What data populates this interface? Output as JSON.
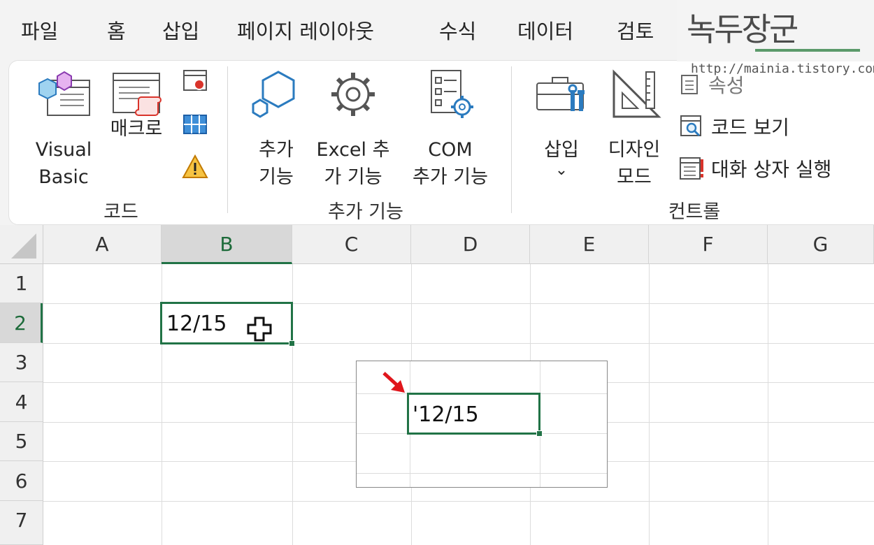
{
  "menu": {
    "tabs": [
      "파일",
      "홈",
      "삽입",
      "페이지 레이아웃",
      "수식",
      "데이터",
      "검토"
    ]
  },
  "watermark": {
    "title": "녹두장군",
    "url": "http://mainia.tistory.com"
  },
  "ribbon": {
    "groups": {
      "code": {
        "label": "코드",
        "visual_basic": [
          "Visual",
          "Basic"
        ],
        "macro": "매크로",
        "small_icons": [
          "record-macro-icon",
          "relative-reference-icon",
          "macro-security-icon"
        ]
      },
      "addins": {
        "label": "추가 기능",
        "addins_button": [
          "추가",
          "기능"
        ],
        "excel_addins": [
          "Excel 추",
          "가 기능"
        ],
        "com_addins": [
          "COM",
          "추가 기능"
        ]
      },
      "controls": {
        "label": "컨트롤",
        "insert": "삽입",
        "insert_chevron": "⌄",
        "design_mode": [
          "디자인",
          "모드"
        ],
        "properties": "속성",
        "view_code": "코드 보기",
        "run_dialog": "대화 상자 실행"
      }
    }
  },
  "sheet": {
    "columns": [
      "A",
      "B",
      "C",
      "D",
      "E",
      "F",
      "G"
    ],
    "selected_column": "B",
    "rows": [
      "1",
      "2",
      "3",
      "4",
      "5",
      "6",
      "7"
    ],
    "selected_row": "2",
    "cell_b2": "12/15",
    "inset_cell": "'12/15"
  },
  "colors": {
    "excel_green": "#217346",
    "arrow_red": "#e0161c"
  }
}
